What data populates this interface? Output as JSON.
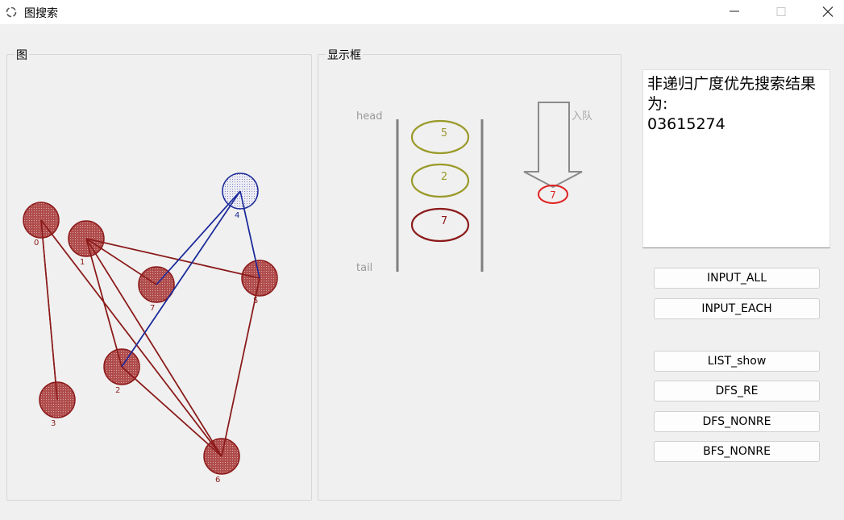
{
  "window": {
    "title": "图搜索",
    "app_icon": "ring-spinner-icon",
    "controls": [
      "minimize-icon",
      "maximize-icon",
      "close-icon"
    ]
  },
  "graph_panel": {
    "label": "图",
    "nodes": [
      {
        "id": "0",
        "state": "visited"
      },
      {
        "id": "1",
        "state": "visited"
      },
      {
        "id": "2",
        "state": "visited"
      },
      {
        "id": "3",
        "state": "visited"
      },
      {
        "id": "4",
        "state": "current"
      },
      {
        "id": "5",
        "state": "visited"
      },
      {
        "id": "6",
        "state": "visited"
      },
      {
        "id": "7",
        "state": "visited"
      }
    ],
    "edges": [
      {
        "from": "0",
        "to": "3",
        "type": "visited"
      },
      {
        "from": "0",
        "to": "6",
        "type": "visited"
      },
      {
        "from": "1",
        "to": "2",
        "type": "visited"
      },
      {
        "from": "1",
        "to": "7",
        "type": "visited"
      },
      {
        "from": "1",
        "to": "5",
        "type": "visited"
      },
      {
        "from": "1",
        "to": "6",
        "type": "visited"
      },
      {
        "from": "2",
        "to": "6",
        "type": "visited"
      },
      {
        "from": "5",
        "to": "6",
        "type": "visited"
      },
      {
        "from": "4",
        "to": "2",
        "type": "active"
      },
      {
        "from": "4",
        "to": "7",
        "type": "active"
      },
      {
        "from": "4",
        "to": "5",
        "type": "active"
      }
    ],
    "colors": {
      "visited": "#8b1a1a",
      "active": "#1a2a9a",
      "current_fill": "#e8e8f4"
    }
  },
  "display_panel": {
    "label": "显示框",
    "head_label": "head",
    "tail_label": "tail",
    "queue": [
      {
        "value": "5",
        "color": "#9a9a2a"
      },
      {
        "value": "2",
        "color": "#9a9a2a"
      },
      {
        "value": "7",
        "color": "#8b1a1a"
      }
    ],
    "enqueue_label": "入队",
    "enqueue_value": "7",
    "enqueue_color": "#e02020"
  },
  "result": {
    "line1": "非递归广度优先搜索结果",
    "line2": "为:",
    "line3": "03615274"
  },
  "buttons": {
    "input_all": "INPUT_ALL",
    "input_each": "INPUT_EACH",
    "list_show": "LIST_show",
    "dfs_re": "DFS_RE",
    "dfs_nonre": "DFS_NONRE",
    "bfs_nonre": "BFS_NONRE"
  }
}
